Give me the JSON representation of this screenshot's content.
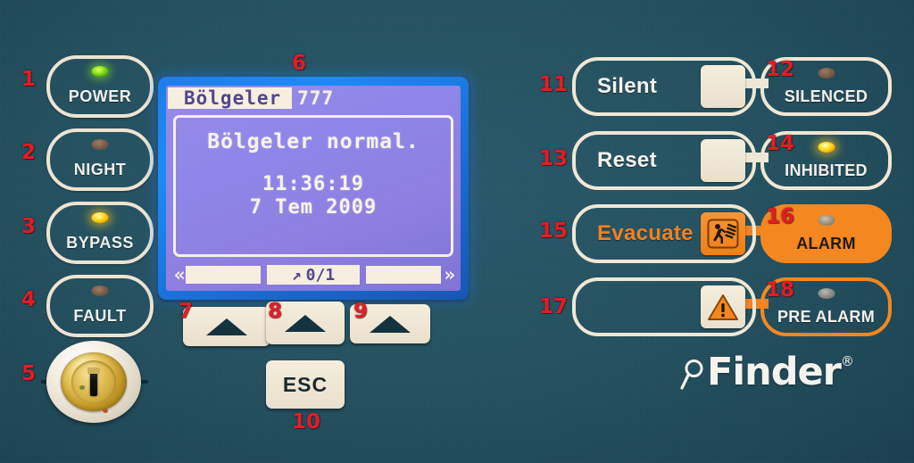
{
  "panel": {
    "background_color": "#23505f",
    "accent_cream": "#efe7d5",
    "accent_orange": "#f4871f",
    "callout_red": "#e11d26"
  },
  "left_buttons": [
    {
      "number": "1",
      "label": "POWER",
      "led": "green",
      "led_state": "lit"
    },
    {
      "number": "2",
      "label": "NIGHT",
      "led": "off",
      "led_state": "unlit"
    },
    {
      "number": "3",
      "label": "BYPASS",
      "led": "yellow",
      "led_state": "lit"
    },
    {
      "number": "4",
      "label": "FAULT",
      "led": "off",
      "led_state": "unlit"
    }
  ],
  "key_switch": {
    "number": "5",
    "name": "key-switch",
    "state": "vertical"
  },
  "display": {
    "number": "6",
    "title": "Bölgeler",
    "title_code": "777",
    "message": "Bölgeler normal.",
    "time": "11:36:19",
    "date": "7 Tem 2009",
    "soft_left": "«",
    "soft_middle_arrow": "↗",
    "soft_middle_text": "0/1",
    "soft_right": "»"
  },
  "arrow_keys": [
    {
      "number": "7",
      "icon": "triangle-up-icon"
    },
    {
      "number": "8",
      "icon": "triangle-up-icon"
    },
    {
      "number": "9",
      "icon": "triangle-up-icon"
    }
  ],
  "esc_key": {
    "number": "10",
    "label": "ESC"
  },
  "commands": [
    {
      "number": "11",
      "label": "Silent",
      "pad": "blank-pad"
    },
    {
      "number": "13",
      "label": "Reset",
      "pad": "blank-pad"
    },
    {
      "number": "15",
      "label": "Evacuate",
      "pad": "running-man-icon"
    },
    {
      "number": "17",
      "label": "",
      "pad": "warning-triangle-icon"
    }
  ],
  "indicators": [
    {
      "number": "12",
      "label": "SILENCED",
      "led_state": "unlit",
      "style": "cream-outline"
    },
    {
      "number": "14",
      "label": "INHIBITED",
      "led_state": "lit-yellow",
      "style": "cream-outline"
    },
    {
      "number": "16",
      "label": "ALARM",
      "led_state": "unlit",
      "style": "orange-solid"
    },
    {
      "number": "18",
      "label": "PRE ALARM",
      "led_state": "unlit",
      "style": "orange-outline"
    }
  ],
  "brand": {
    "name": "Finder",
    "registered_mark": "®",
    "icon": "magnifier-icon"
  }
}
